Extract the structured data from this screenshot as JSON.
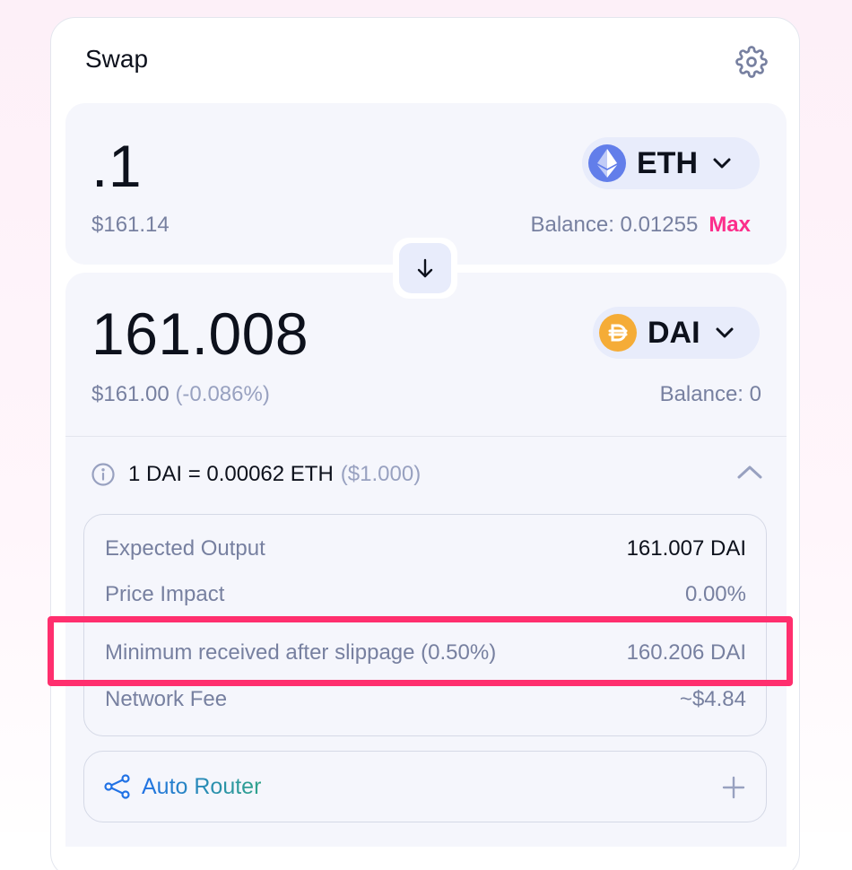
{
  "header": {
    "title": "Swap"
  },
  "input": {
    "amount": ".1",
    "usd_value": "$161.14",
    "token": "ETH",
    "balance": "Balance: 0.01255",
    "max_label": "Max"
  },
  "output": {
    "amount": "161.008",
    "usd_value": "$161.00",
    "price_impact_delta": "(-0.086%)",
    "token": "DAI",
    "balance": "Balance: 0"
  },
  "rate": {
    "text": "1 DAI = 0.00062 ETH",
    "usd": "($1.000)"
  },
  "details": [
    {
      "label": "Expected Output",
      "value": "161.007 DAI"
    },
    {
      "label": "Price Impact",
      "value": "0.00%"
    },
    {
      "label": "Minimum received after slippage (0.50%)",
      "value": "160.206 DAI"
    },
    {
      "label": "Network Fee",
      "value": "~$4.84"
    }
  ],
  "router": {
    "label": "Auto Router"
  },
  "colors": {
    "accent_pink": "#fc2e8b",
    "highlight": "#ff2f6e",
    "eth_icon": "#627eea",
    "dai_icon": "#f5ac37"
  },
  "icons": [
    "gear-icon",
    "eth-icon",
    "dai-icon",
    "chevron-down-icon",
    "arrow-down-icon",
    "info-icon",
    "chevron-up-icon",
    "router-icon",
    "plus-icon"
  ]
}
